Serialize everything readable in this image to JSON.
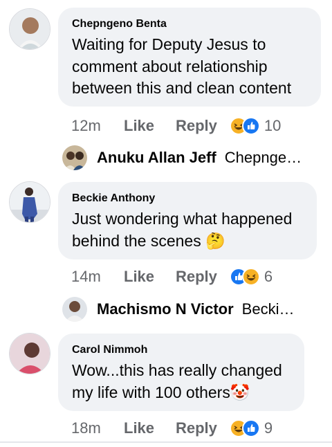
{
  "comments": [
    {
      "author": "Chepngeno Benta",
      "text": "Waiting for Deputy Jesus to comment about relationship between this and clean content",
      "time": "12m",
      "like_label": "Like",
      "reply_label": "Reply",
      "reactions": [
        "haha-icon",
        "like-icon"
      ],
      "reaction_count": "10",
      "reply_preview": {
        "name": "Anuku Allan Jeff",
        "snippet": "Chepnge…"
      }
    },
    {
      "author": "Beckie Anthony",
      "text": "Just wondering what happened behind the scenes 🤔",
      "time": "14m",
      "like_label": "Like",
      "reply_label": "Reply",
      "reactions": [
        "like-icon",
        "haha-icon"
      ],
      "reaction_count": "6",
      "reply_preview": {
        "name": "Machismo N Victor",
        "snippet": "Becki…"
      }
    },
    {
      "author": "Carol Nimmoh",
      "text": "Wow...this has really changed my life with 100 others🤡",
      "time": "18m",
      "like_label": "Like",
      "reply_label": "Reply",
      "reactions": [
        "haha-icon",
        "like-icon"
      ],
      "reaction_count": "9"
    }
  ],
  "colors": {
    "bubble": "#f0f2f5",
    "meta_text": "#65676b",
    "like_blue": "#1877f2",
    "haha_yellow": "#f7b125"
  }
}
